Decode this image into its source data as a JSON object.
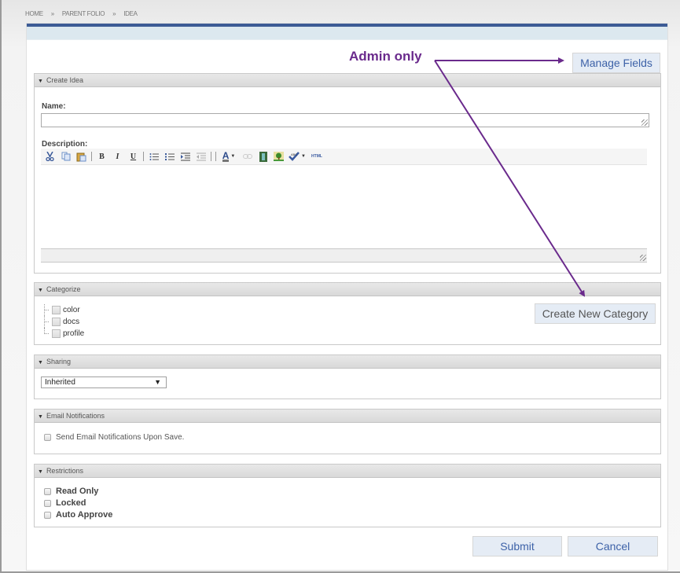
{
  "breadcrumb": {
    "items": [
      "HOME",
      "PARENT FOLIO",
      "IDEA"
    ],
    "separator": "»"
  },
  "annotation": {
    "text": "Admin only",
    "color": "#6a2a8c"
  },
  "buttons": {
    "manage_fields": "Manage Fields",
    "create_new_category": "Create New Category",
    "submit": "Submit",
    "cancel": "Cancel"
  },
  "panels": {
    "create_idea": {
      "title": "Create Idea",
      "name_label": "Name:",
      "name_value": "",
      "description_label": "Description:",
      "toolbar": [
        "cut",
        "copy",
        "paste",
        "bold",
        "italic",
        "underline",
        "bullet-list",
        "numbered-list",
        "indent",
        "outdent",
        "font-color",
        "link",
        "media",
        "image",
        "spellcheck",
        "html"
      ],
      "toolbar_glyphs": {
        "bold": "B",
        "italic": "I",
        "underline": "U",
        "font_color": "A",
        "html": "HTML"
      }
    },
    "categorize": {
      "title": "Categorize",
      "items": [
        "color",
        "docs",
        "profile"
      ]
    },
    "sharing": {
      "title": "Sharing",
      "selected": "Inherited",
      "arrow": "▼"
    },
    "email": {
      "title": "Email Notifications",
      "option": "Send Email Notifications Upon Save."
    },
    "restrictions": {
      "title": "Restrictions",
      "options": [
        "Read Only",
        "Locked",
        "Auto Approve"
      ]
    }
  },
  "colors": {
    "accent_bar": "#3c5b95",
    "button_text": "#3d62a8",
    "button_bg": "#e5ecf5"
  }
}
